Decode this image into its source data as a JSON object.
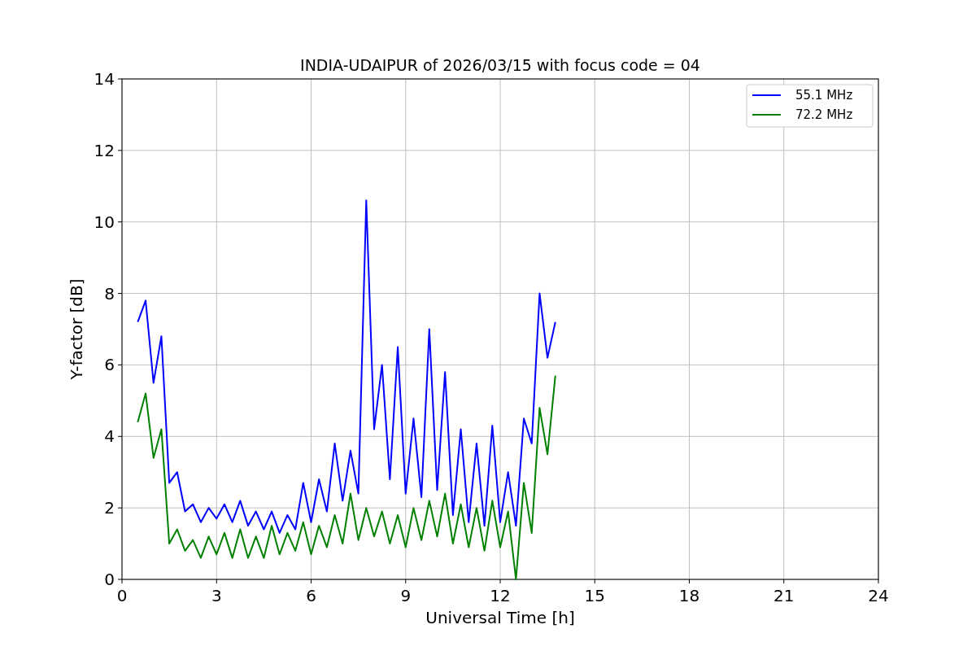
{
  "figure": {
    "chart_data": {
      "type": "line",
      "title": "INDIA-UDAIPUR of 2026/03/15 with focus code = 04",
      "xlabel": "Universal Time [h]",
      "ylabel": "Y-factor [dB]",
      "xlim": [
        0,
        24
      ],
      "ylim": [
        0,
        14
      ],
      "xticks": [
        0,
        3,
        6,
        9,
        12,
        15,
        18,
        21,
        24
      ],
      "yticks": [
        0,
        2,
        4,
        6,
        8,
        10,
        12,
        14
      ],
      "grid": true,
      "legend": true,
      "x": [
        0.5,
        0.75,
        1.0,
        1.25,
        1.5,
        1.75,
        2.0,
        2.25,
        2.5,
        2.75,
        3.0,
        3.25,
        3.5,
        3.75,
        4.0,
        4.25,
        4.5,
        4.75,
        5.0,
        5.25,
        5.5,
        5.75,
        6.0,
        6.25,
        6.5,
        6.75,
        7.0,
        7.25,
        7.5,
        7.75,
        8.0,
        8.25,
        8.5,
        8.75,
        9.0,
        9.25,
        9.5,
        9.75,
        10.0,
        10.25,
        10.5,
        10.75,
        11.0,
        11.25,
        11.5,
        11.75,
        12.0,
        12.25,
        12.5,
        12.75,
        13.0,
        13.25,
        13.5,
        13.75
      ],
      "series": [
        {
          "name": "55.1 MHz",
          "color": "#0000ff",
          "values": [
            7.2,
            7.8,
            5.5,
            6.8,
            2.7,
            3.0,
            1.9,
            2.1,
            1.6,
            2.0,
            1.7,
            2.1,
            1.6,
            2.2,
            1.5,
            1.9,
            1.4,
            1.9,
            1.3,
            1.8,
            1.4,
            2.7,
            1.6,
            2.8,
            1.9,
            3.8,
            2.2,
            3.6,
            2.4,
            10.6,
            4.2,
            6.0,
            2.8,
            6.5,
            2.4,
            4.5,
            2.3,
            7.0,
            2.5,
            5.8,
            1.8,
            4.2,
            1.6,
            3.8,
            1.5,
            4.3,
            1.6,
            3.0,
            1.5,
            4.5,
            3.8,
            8.0,
            6.2,
            7.2
          ]
        },
        {
          "name": "72.2 MHz",
          "color": "#008000",
          "values": [
            4.4,
            5.2,
            3.4,
            4.2,
            1.0,
            1.4,
            0.8,
            1.1,
            0.6,
            1.2,
            0.7,
            1.3,
            0.6,
            1.4,
            0.6,
            1.2,
            0.6,
            1.5,
            0.7,
            1.3,
            0.8,
            1.6,
            0.7,
            1.5,
            0.9,
            1.8,
            1.0,
            2.4,
            1.1,
            2.0,
            1.2,
            1.9,
            1.0,
            1.8,
            0.9,
            2.0,
            1.1,
            2.2,
            1.2,
            2.4,
            1.0,
            2.1,
            0.9,
            2.0,
            0.8,
            2.2,
            0.9,
            1.9,
            0.0,
            2.7,
            1.3,
            4.8,
            3.5,
            5.7
          ]
        }
      ]
    }
  }
}
